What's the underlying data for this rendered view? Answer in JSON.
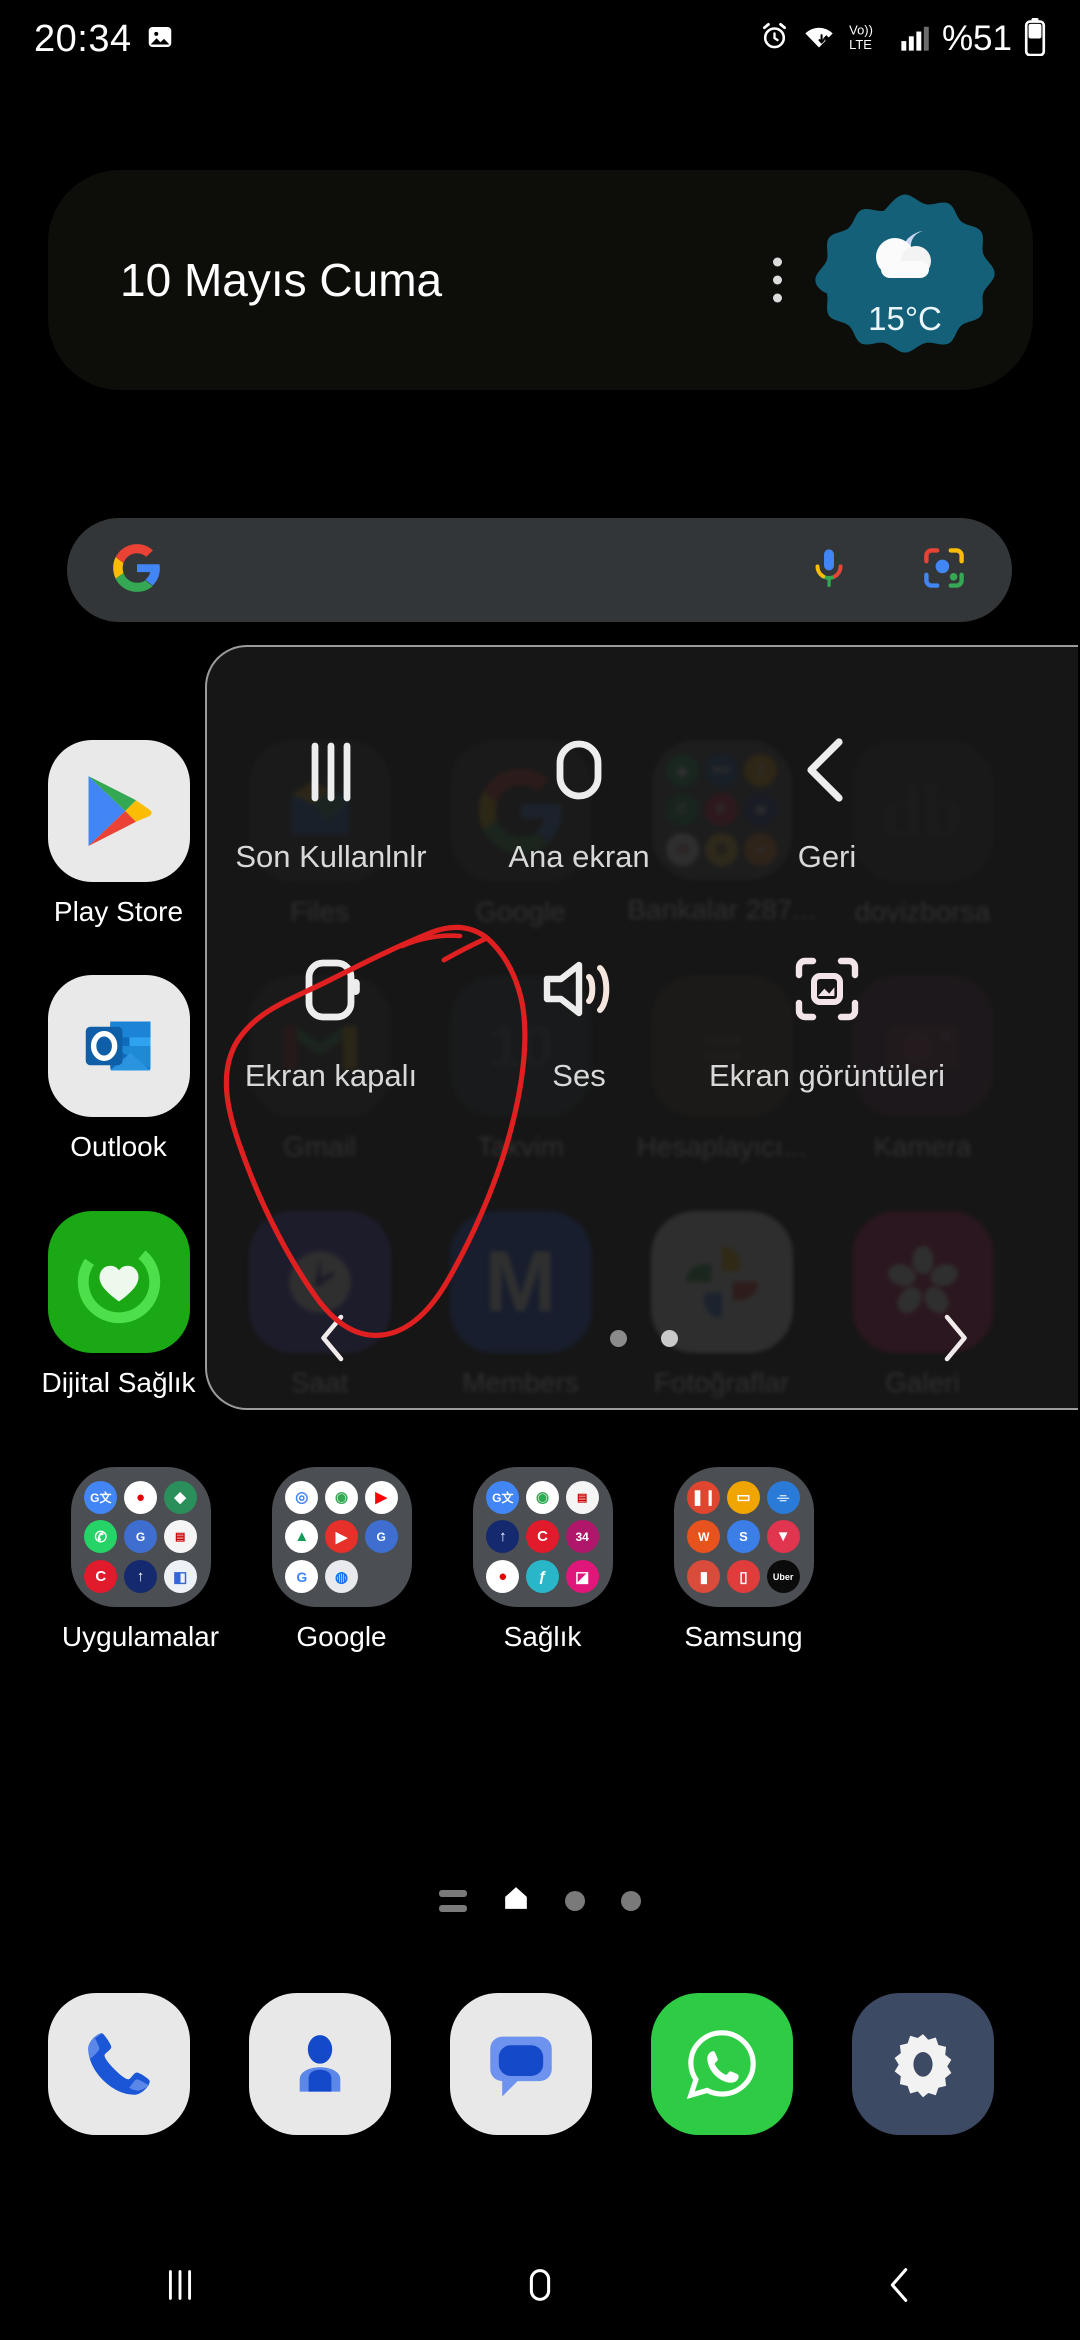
{
  "status_bar": {
    "time": "20:34",
    "battery_text": "%51",
    "icons": [
      "image-icon",
      "alarm-icon",
      "wifi-icon",
      "volte-icon",
      "signal-icon",
      "battery-icon"
    ],
    "network_label": "Vo))",
    "network_sub": "LTE"
  },
  "weather_widget": {
    "date": "10 Mayıs Cuma",
    "temperature": "15°C",
    "badge_color": "#156079",
    "menu_icon": "more-vertical-icon",
    "condition_icon": "cloud-moon-icon"
  },
  "search_bar": {
    "placeholder": "",
    "google_icon": "google-g-icon",
    "mic_icon": "microphone-icon",
    "lens_icon": "google-lens-icon"
  },
  "home_screen": {
    "row1": [
      {
        "label": "Play Store",
        "icon": "play-store-icon"
      },
      {
        "label": "Files",
        "icon": "files-icon"
      },
      {
        "label": "Google",
        "icon": "google-icon"
      },
      {
        "label": "Bankalar 287...",
        "icon": "folder-bankalar-icon"
      },
      {
        "label": "dovizborsa",
        "icon": "dovizborsa-icon"
      }
    ],
    "row2": [
      {
        "label": "Outlook",
        "icon": "outlook-icon"
      },
      {
        "label": "Gmail",
        "icon": "gmail-icon"
      },
      {
        "label": "Takvim",
        "icon": "calendar-icon"
      },
      {
        "label": "Hesaplayıcı...",
        "icon": "calculator-icon"
      },
      {
        "label": "Kamera",
        "icon": "camera-icon"
      }
    ],
    "row3": [
      {
        "label": "Dijital Sağlık",
        "icon": "digital-wellbeing-icon"
      },
      {
        "label": "Saat",
        "icon": "clock-icon"
      },
      {
        "label": "Members",
        "icon": "samsung-members-icon"
      },
      {
        "label": "Fotoğraflar",
        "icon": "google-photos-icon"
      },
      {
        "label": "Galeri",
        "icon": "gallery-icon"
      }
    ],
    "folders": [
      {
        "label": "Uygulamalar"
      },
      {
        "label": "Google"
      },
      {
        "label": "Sağlık"
      },
      {
        "label": "Samsung"
      }
    ]
  },
  "page_indicator": {
    "app_list_icon": "app-list-icon",
    "home_icon": "home-page-icon",
    "dots": 2
  },
  "dock": [
    {
      "label": "",
      "icon": "phone-icon"
    },
    {
      "label": "",
      "icon": "contacts-icon"
    },
    {
      "label": "",
      "icon": "messages-icon"
    },
    {
      "label": "",
      "icon": "whatsapp-icon"
    },
    {
      "label": "",
      "icon": "settings-icon"
    }
  ],
  "assistant_menu": {
    "row1": [
      {
        "label": "Son Kullanlnlr",
        "icon": "recents-icon"
      },
      {
        "label": "Ana ekran",
        "icon": "home-icon"
      },
      {
        "label": "Geri",
        "icon": "back-icon"
      }
    ],
    "row2": [
      {
        "label": "Ekran kapalı",
        "icon": "screen-off-icon"
      },
      {
        "label": "Ses",
        "icon": "volume-icon"
      },
      {
        "label": "Ekran görüntüleri",
        "icon": "screenshot-icon"
      }
    ],
    "prev_arrow": "chevron-left-icon",
    "next_arrow": "chevron-right-icon",
    "page_count": 2,
    "active_page": 2
  },
  "annotation": {
    "color": "#e02020",
    "shape": "hand-drawn-circle",
    "targets": "Ekran kapalı"
  },
  "nav_bar": {
    "recents_icon": "nav-recents-icon",
    "home_icon": "nav-home-icon",
    "back_icon": "nav-back-icon"
  }
}
